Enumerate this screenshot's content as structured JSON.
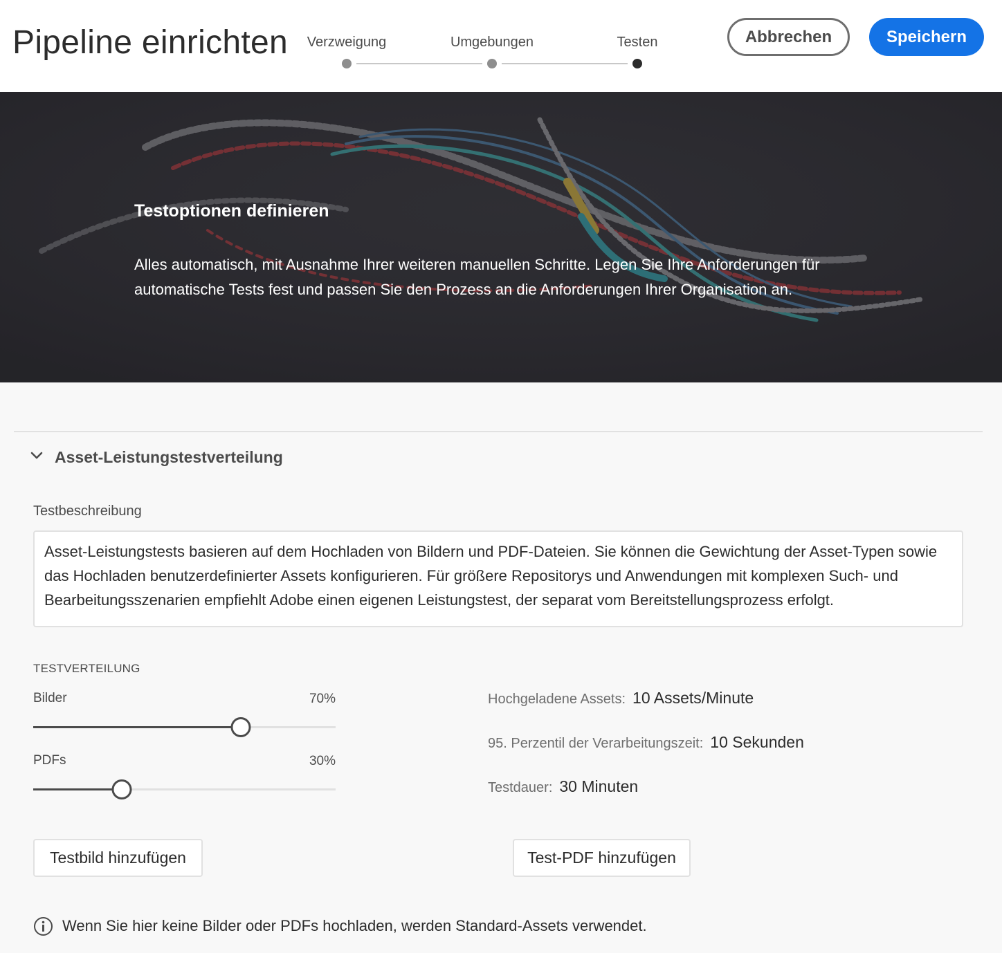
{
  "header": {
    "title": "Pipeline einrichten",
    "steps": [
      {
        "label": "Verzweigung",
        "state": "completed"
      },
      {
        "label": "Umgebungen",
        "state": "completed"
      },
      {
        "label": "Testen",
        "state": "current"
      }
    ],
    "cancel_label": "Abbrechen",
    "save_label": "Speichern"
  },
  "hero": {
    "title": "Testoptionen definieren",
    "text": "Alles automatisch, mit Ausnahme Ihrer weiteren manuellen Schritte. Legen Sie Ihre Anforderungen für automatische Tests fest und passen Sie den Prozess an die Anforderungen Ihrer Organisation an."
  },
  "accordion": {
    "title": "Asset-Leistungstestverteilung",
    "expanded": true,
    "icon": "chevron-down-icon"
  },
  "description": {
    "label": "Testbeschreibung",
    "value": "Asset-Leistungstests basieren auf dem Hochladen von Bildern und PDF-Dateien. Sie können die Gewichtung der Asset-Typen sowie das Hochladen benutzerdefinierter Assets konfigurieren. Für größere Repositorys und Anwendungen mit komplexen Such- und Bearbeitungsszenarien empfiehlt Adobe einen eigenen Leistungstest, der separat vom Bereitstellungsprozess erfolgt."
  },
  "distribution": {
    "section_label": "TESTVERTEILUNG",
    "images": {
      "label": "Bilder",
      "value_text": "70%",
      "value": 0.7
    },
    "pdfs": {
      "label": "PDFs",
      "value_text": "30%",
      "value": 0.3
    }
  },
  "stats": {
    "uploaded": {
      "label": "Hochgeladene Assets:",
      "value": "10 Assets/Minute"
    },
    "percentile": {
      "label": "95. Perzentil der Verarbeitungszeit:",
      "value": "10 Sekunden"
    },
    "duration": {
      "label": "Testdauer:",
      "value": "30 Minuten"
    }
  },
  "actions": {
    "add_image": "Testbild hinzufügen",
    "add_pdf": "Test-PDF hinzufügen"
  },
  "info": {
    "icon": "info-icon",
    "text": "Wenn Sie hier keine Bilder oder PDFs hochladen, werden Standard-Assets verwendet."
  },
  "colors": {
    "accent": "#1473e6",
    "hero_bg": "#27262b",
    "track_fill": "#4b4b4b",
    "track": "#e1e1e1"
  }
}
